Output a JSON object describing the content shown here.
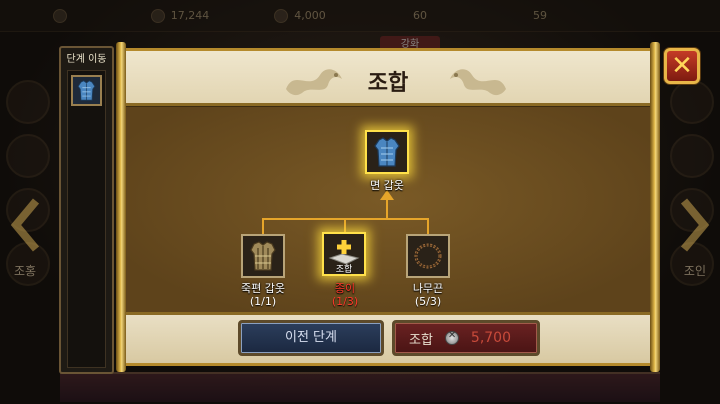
{
  "background": {
    "topbar": [
      "17,244",
      "4,000",
      "60",
      "59"
    ],
    "tab_label": "강화",
    "left_nav_label": "조홍",
    "right_nav_label": "조인"
  },
  "step_panel": {
    "title": "단계 이동",
    "items": [
      {
        "icon": "blue-armor-icon"
      }
    ]
  },
  "dialog": {
    "title": "조합",
    "close_icon": "x-icon",
    "result": {
      "name": "면 갑옷",
      "icon": "blue-armor-icon"
    },
    "ingredients": [
      {
        "name": "죽편 갑옷",
        "count": "(1/1)",
        "icon": "bamboo-armor-icon",
        "sufficient": true
      },
      {
        "name": "종이",
        "count": "(1/3)",
        "icon": "paper-icon",
        "sufficient": false,
        "badge": "조합"
      },
      {
        "name": "나무끈",
        "count": "(5/3)",
        "icon": "rope-icon",
        "sufficient": true
      }
    ],
    "prev_button": "이전 단계",
    "combine_button": {
      "label": "조합",
      "cost": "5,700",
      "currency_icon": "silver-coin-icon"
    }
  },
  "colors": {
    "insufficient": "#ff3a2a",
    "glow": "#ffe14a",
    "rod_gold": "#e2b94a"
  }
}
